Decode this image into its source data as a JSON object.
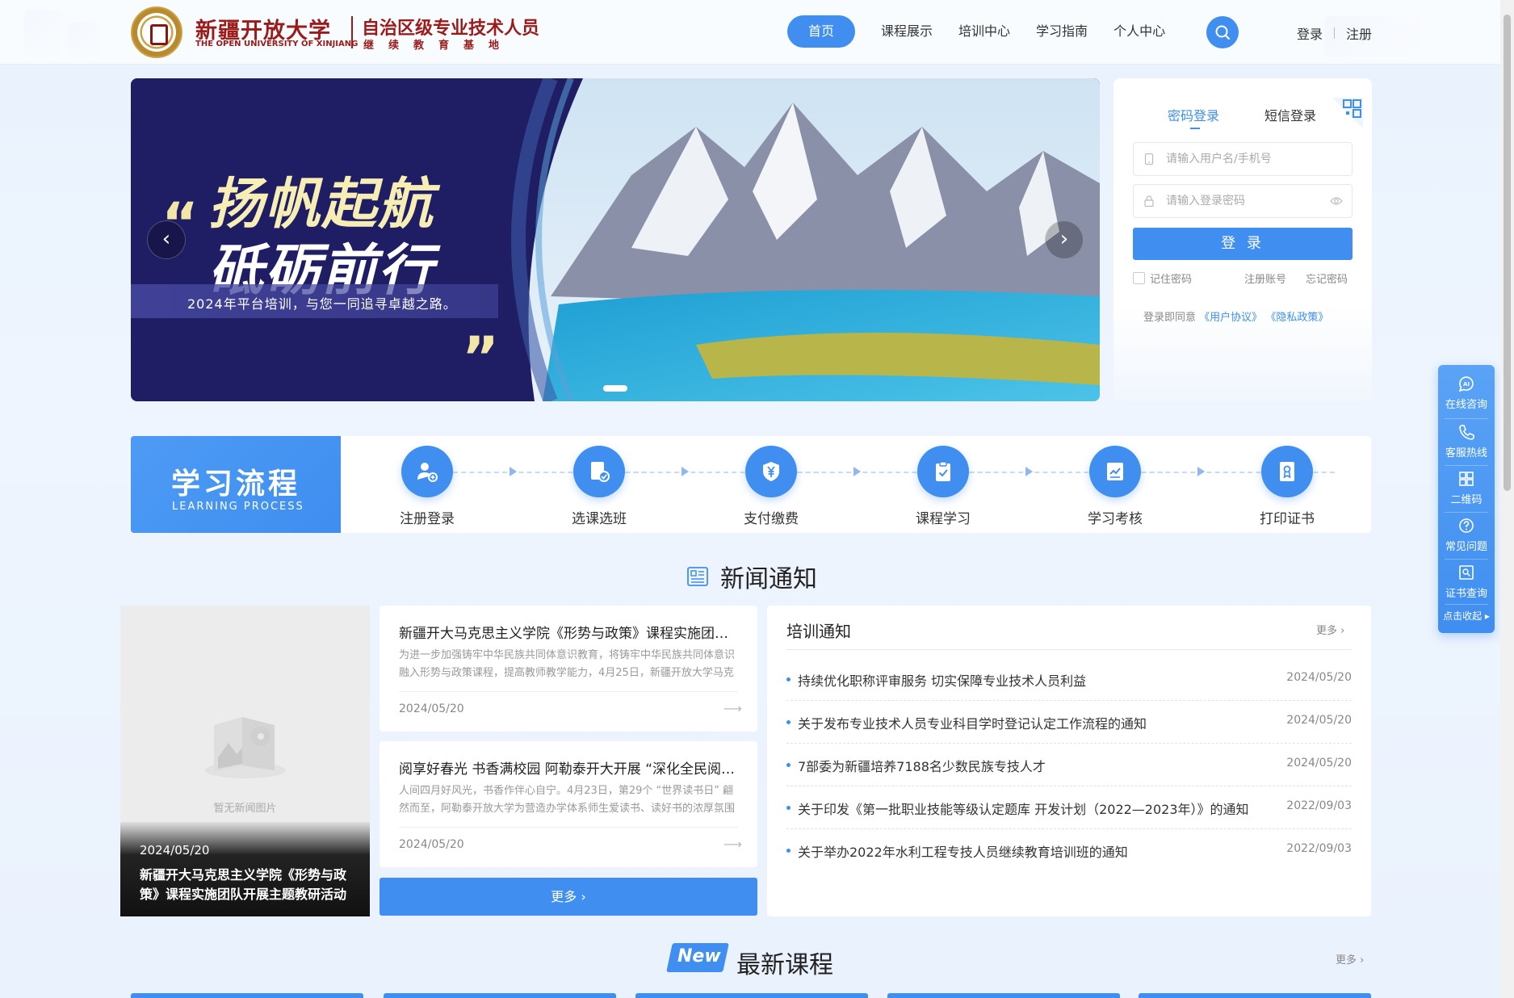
{
  "header": {
    "logo_cn": "新疆开放大学",
    "logo_en": "THE OPEN UNIVERSITY OF XINJIANG",
    "logo_sub1": "自治区级专业技术人员",
    "logo_sub2": "继续教育基地",
    "nav": [
      "首页",
      "课程展示",
      "培训中心",
      "学习指南",
      "个人中心"
    ],
    "login": "登录",
    "register": "注册"
  },
  "banner": {
    "title_line1": "扬帆起航",
    "title_line2": "砥砺前行",
    "quote_open": "“",
    "quote_close": "”",
    "subtitle": "2024年平台培训，与您一同追寻卓越之路。"
  },
  "login_panel": {
    "tab_password": "密码登录",
    "tab_sms": "短信登录",
    "username_placeholder": "请输入用户名/手机号",
    "password_placeholder": "请输入登录密码",
    "login_button": "登 录",
    "remember": "记住密码",
    "register_account": "注册账号",
    "forgot_password": "忘记密码",
    "agree_prefix": "登录即同意",
    "user_agreement": "《用户协议》",
    "privacy_policy": "《隐私政策》"
  },
  "process": {
    "title": "学习流程",
    "title_en": "LEARNING PROCESS",
    "steps": [
      "注册登录",
      "选课选班",
      "支付缴费",
      "课程学习",
      "学习考核",
      "打印证书"
    ]
  },
  "news": {
    "heading": "新闻通知",
    "feature": {
      "no_image": "暂无新闻图片",
      "date": "2024/05/20",
      "title": "新疆开大马克思主义学院《形势与政策》课程实施团队开展主题教研活动"
    },
    "cards": [
      {
        "title": "新疆开大马克思主义学院《形势与政策》课程实施团队开展主题教研活动",
        "desc": "为进一步加强铸牢中华民族共同体意识教育，将铸牢中华民族共同体意识融入形势与政策课程，提高教师教学能力，4月25日，新疆开放大学马克思主义学院",
        "date": "2024/05/20"
      },
      {
        "title": "阅享好春光 书香满校园 阿勒泰开大开展 “深化全民阅读”活动",
        "desc": "人间四月好风光，书香作伴心自宁。4月23日，第29个 “世界读书日” 翩然而至，阿勒泰开放大学为营造办学体系师生爱读书、读好书的浓厚氛围",
        "date": "2024/05/20"
      }
    ],
    "more": "更多",
    "training": {
      "title": "培训通知",
      "more": "更多",
      "items": [
        {
          "text": "持续优化职称评审服务 切实保障专业技术人员利益",
          "date": "2024/05/20"
        },
        {
          "text": "关于发布专业技术人员专业科目学时登记认定工作流程的通知",
          "date": "2024/05/20"
        },
        {
          "text": "7部委为新疆培养7188名少数民族专技人才",
          "date": "2024/05/20"
        },
        {
          "text": "关于印发《第一批职业技能等级认定题库 开发计划（2022—2023年）》的通知",
          "date": "2022/09/03"
        },
        {
          "text": "关于举办2022年水利工程专技人员继续教育培训班的通知",
          "date": "2022/09/03"
        }
      ]
    }
  },
  "courses": {
    "badge": "New",
    "title": "最新课程",
    "more": "更多"
  },
  "float_bar": {
    "items": [
      "在线咨询",
      "客服热线",
      "二维码",
      "常见问题",
      "证书查询"
    ],
    "collapse": "点击收起"
  },
  "colors": {
    "primary": "#3f8ef0",
    "brand_red": "#9b1b1b"
  }
}
